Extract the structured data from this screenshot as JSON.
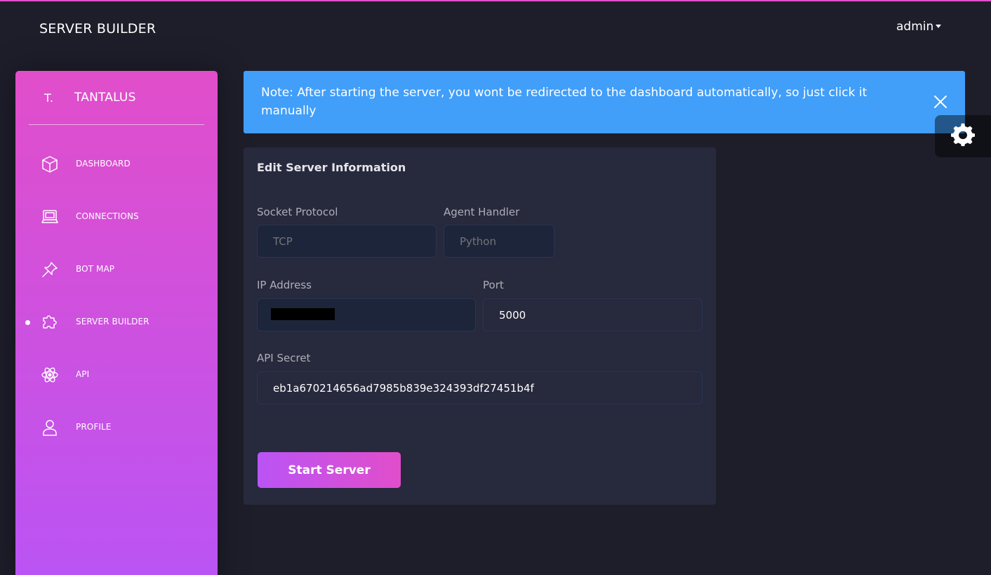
{
  "navbar": {
    "brand": "SERVER BUILDER",
    "user_menu_label": "admin",
    "user_menu_icon": "caret-down-icon"
  },
  "sidebar": {
    "logo_mini": "T.",
    "logo_text": "TANTALUS",
    "items": [
      {
        "label": "DASHBOARD",
        "icon": "cube-icon",
        "active": false
      },
      {
        "label": "CONNECTIONS",
        "icon": "laptop-icon",
        "active": false
      },
      {
        "label": "BOT MAP",
        "icon": "pin-icon",
        "active": false
      },
      {
        "label": "SERVER BUILDER",
        "icon": "puzzle-icon",
        "active": true
      },
      {
        "label": "API",
        "icon": "atom-icon",
        "active": false
      },
      {
        "label": "PROFILE",
        "icon": "user-icon",
        "active": false
      }
    ]
  },
  "alert": {
    "text": "Note: After starting the server, you wont be redirected to the dashboard automatically, so just click it manually",
    "close_icon": "close-icon"
  },
  "fixed_plugin": {
    "icon": "gear-icon"
  },
  "form": {
    "title": "Edit Server Information",
    "socket_protocol": {
      "label": "Socket Protocol",
      "placeholder": "TCP"
    },
    "agent_handler": {
      "label": "Agent Handler",
      "placeholder": "Python"
    },
    "ip_address": {
      "label": "IP Address",
      "value": ""
    },
    "port": {
      "label": "Port",
      "value": "5000"
    },
    "api_secret": {
      "label": "API Secret",
      "value": "eb1a670214656ad7985b839e324393df27451b4f"
    },
    "submit_label": "Start Server"
  },
  "colors": {
    "background": "#1e1e2b",
    "card": "#27293d",
    "sidebar_gradient_start": "#e14eca",
    "sidebar_gradient_end": "#ba54f5",
    "alert": "#419ef9"
  }
}
